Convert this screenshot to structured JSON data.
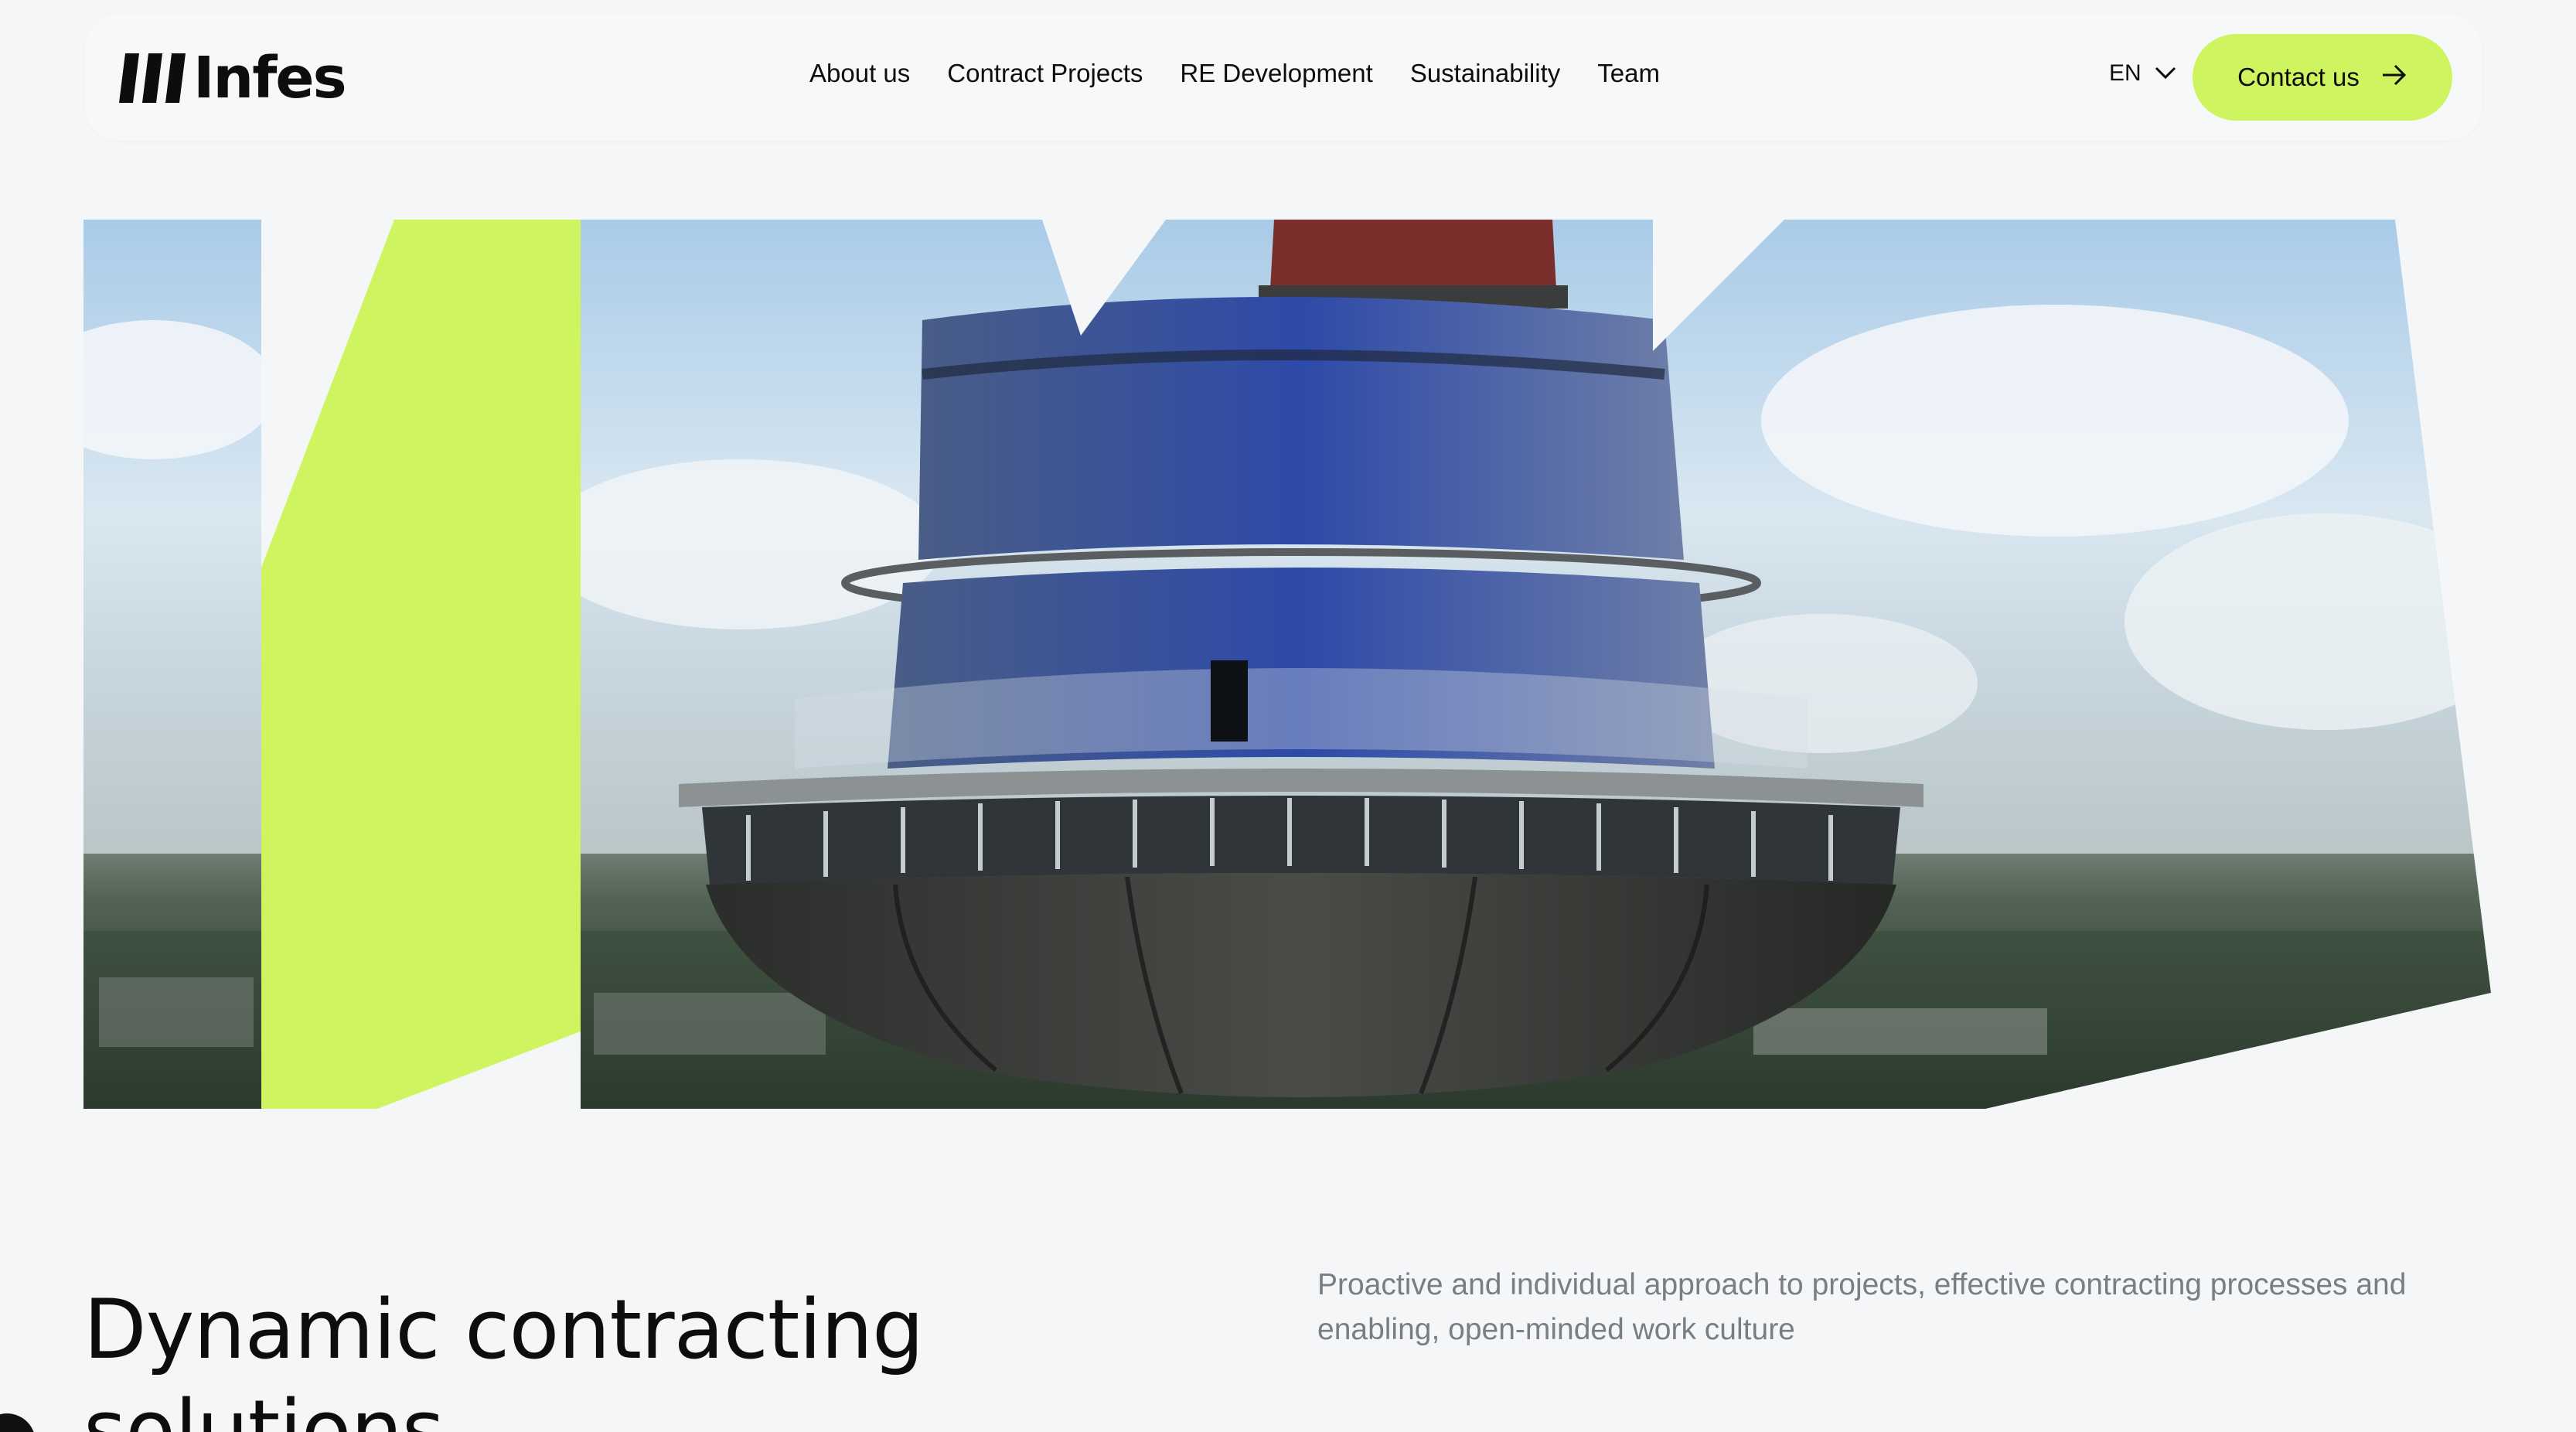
{
  "brand": {
    "name": "Infes",
    "accent": "#cef560",
    "icons": [
      "logo-mark"
    ]
  },
  "nav": {
    "items": [
      {
        "label": "About us"
      },
      {
        "label": "Contract Projects"
      },
      {
        "label": "RE Development"
      },
      {
        "label": "Sustainability"
      },
      {
        "label": "Team"
      }
    ]
  },
  "language": {
    "selected": "EN",
    "icon": "chevron-down-icon"
  },
  "cta": {
    "label": "Contact us",
    "icon": "arrow-right-icon"
  },
  "hero": {
    "image": "tv-tower-observation-deck-aerial"
  },
  "main": {
    "headline": "Dynamic contracting solutions",
    "description": "Proactive and individual approach to projects, effective contracting processes and enabling, open-minded work culture"
  }
}
